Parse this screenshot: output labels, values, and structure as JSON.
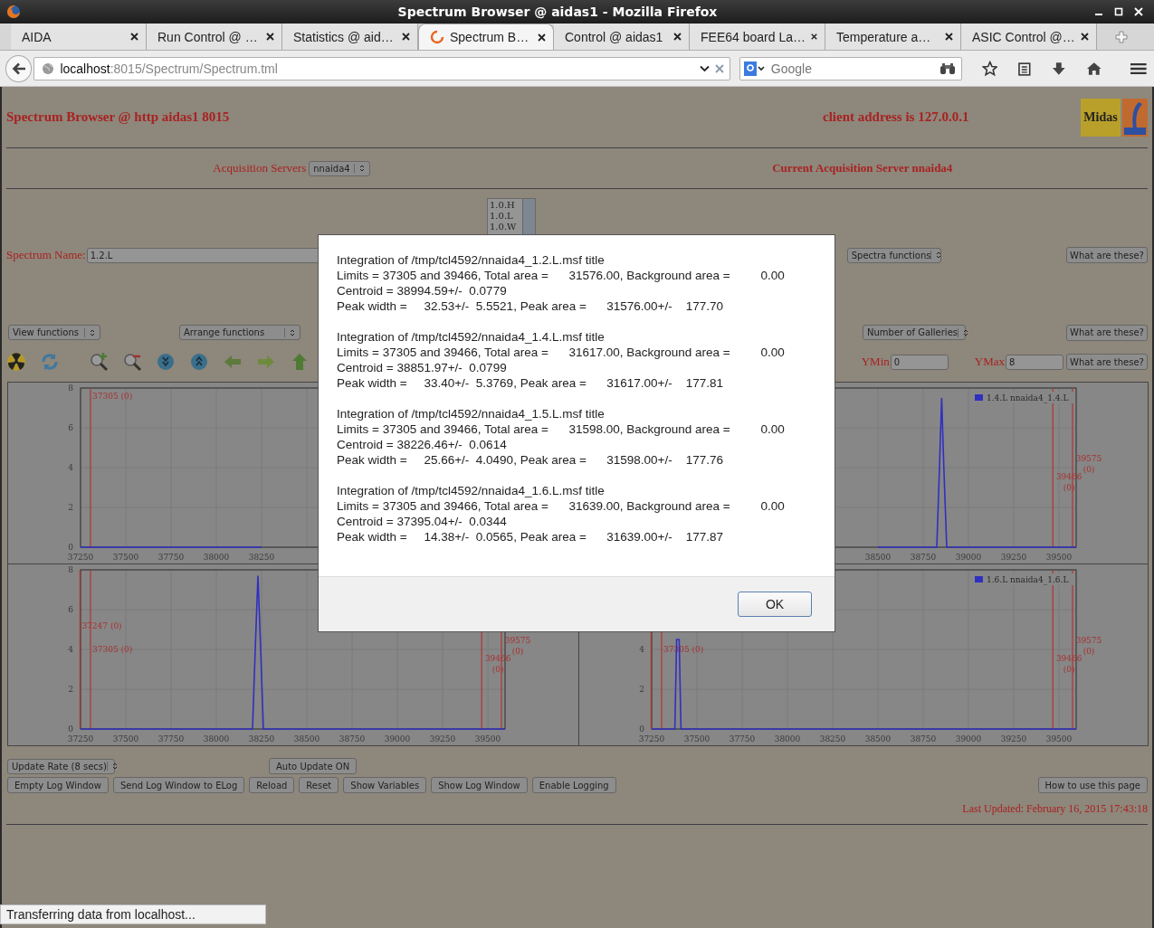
{
  "window": {
    "title": "Spectrum Browser @ aidas1 - Mozilla Firefox"
  },
  "tabs": [
    {
      "label": "AIDA",
      "selected": false,
      "loading": false
    },
    {
      "label": "Run Control @ …",
      "selected": false,
      "loading": false
    },
    {
      "label": "Statistics @ aid…",
      "selected": false,
      "loading": false
    },
    {
      "label": "Spectrum B…",
      "selected": true,
      "loading": true
    },
    {
      "label": "Control @ aidas1",
      "selected": false,
      "loading": false
    },
    {
      "label": "FEE64 board La…",
      "selected": false,
      "loading": false
    },
    {
      "label": "Temperature a…",
      "selected": false,
      "loading": false
    },
    {
      "label": "ASIC Control @…",
      "selected": false,
      "loading": false
    }
  ],
  "address_bar": {
    "host": "localhost",
    "path": ":8015/Spectrum/Spectrum.tml"
  },
  "search": {
    "placeholder": "Google"
  },
  "page": {
    "title": "Spectrum Browser @ http aidas1 8015",
    "client_address": "client address is 127.0.0.1",
    "logo_text": "Midas",
    "acquisition": {
      "label": "Acquisition Servers",
      "value": "nnaida4",
      "current": "Current Acquisition Server nnaida4"
    },
    "spectrum_list": [
      "1.0.H",
      "1.0.L",
      "1.0.W"
    ],
    "spectrum_name": {
      "label": "Spectrum Name:",
      "value": "1.2.L"
    },
    "spectra_functions": "Spectra functions",
    "help_buttons": [
      "What are these?",
      "What are these?",
      "What are these?"
    ],
    "view_functions": "View functions",
    "arrange_functions": "Arrange functions",
    "galleries": "Number of Galleries",
    "ymin": {
      "label": "YMin",
      "value": "0"
    },
    "ymax": {
      "label": "YMax",
      "value": "8"
    },
    "charts": [
      {
        "chart_data": {
          "type": "line",
          "xlim": [
            37250,
            39595
          ],
          "ylim": [
            0,
            8
          ],
          "xticks": [
            37250,
            37500,
            37750,
            38000,
            38250
          ],
          "yticks": [
            0,
            2,
            4,
            6,
            8
          ],
          "x": [
            37250,
            38250
          ],
          "series": [
            {
              "color": "#3030c0",
              "values": [
                0,
                0
              ]
            }
          ],
          "grid": true,
          "ref_lines": [
            {
              "axis": "x",
              "value": 37305,
              "label": "37305 (0)"
            }
          ]
        }
      },
      {
        "chart_data": {
          "type": "line",
          "xlim": [
            37250,
            39595
          ],
          "ylim": [
            0,
            8
          ],
          "xticks": [
            38500,
            38750,
            39000,
            39250,
            39500
          ],
          "x": [
            38500,
            38825,
            38840,
            38852,
            38864,
            38880,
            39595
          ],
          "series": [
            {
              "name": "1.4.L nnaida4_1.4.L",
              "color": "#3030c0",
              "values": [
                0,
                0,
                4,
                7.5,
                4,
                0,
                0
              ]
            }
          ],
          "grid": true,
          "ref_lines": [
            {
              "axis": "x",
              "value": 39466,
              "label": "39466 (0)"
            },
            {
              "axis": "x",
              "value": 39575,
              "label": "39575 (0)"
            }
          ]
        }
      },
      {
        "chart_data": {
          "type": "line",
          "xlim": [
            37250,
            39595
          ],
          "ylim": [
            0,
            8
          ],
          "xticks": [
            37250,
            37500,
            37750,
            38000,
            38250,
            38500,
            38750,
            39000,
            39250,
            39500
          ],
          "yticks": [
            0,
            2,
            4,
            6,
            8
          ],
          "x": [
            37250,
            38200,
            38215,
            38230,
            38245,
            38260,
            39595
          ],
          "series": [
            {
              "color": "#3030c0",
              "values": [
                0,
                0,
                4,
                7.7,
                4,
                0,
                0
              ]
            }
          ],
          "grid": true,
          "ref_lines": [
            {
              "axis": "x",
              "value": 37247,
              "label": "37247 (0)"
            },
            {
              "axis": "x",
              "value": 37305,
              "label": "37305 (0)"
            },
            {
              "axis": "x",
              "value": 39466,
              "label": "39466 (0)"
            },
            {
              "axis": "x",
              "value": 39575,
              "label": "39575 (0)"
            }
          ]
        }
      },
      {
        "chart_data": {
          "type": "line",
          "xlim": [
            37250,
            39595
          ],
          "ylim": [
            0,
            8
          ],
          "xticks": [
            37250,
            37500,
            37750,
            38000,
            38250,
            38500,
            38750,
            39000,
            39250,
            39500
          ],
          "yticks": [
            0,
            2,
            4
          ],
          "x": [
            37250,
            37378,
            37388,
            37402,
            37412,
            39595
          ],
          "series": [
            {
              "name": "1.6.L nnaida4_1.6.L",
              "color": "#3030c0",
              "values": [
                0,
                0,
                4.5,
                4.5,
                0,
                0
              ]
            }
          ],
          "grid": true,
          "ref_lines": [
            {
              "axis": "x",
              "value": 37247
            },
            {
              "axis": "x",
              "value": 37305,
              "label": "37305 (0)"
            },
            {
              "axis": "x",
              "value": 39466,
              "label": "39466 (0)"
            },
            {
              "axis": "x",
              "value": 39575,
              "label": "39575 (0)"
            }
          ]
        }
      }
    ],
    "update_rate": "Update Rate (8 secs)",
    "auto_update": "Auto Update ON",
    "buttons": [
      "Empty Log Window",
      "Send Log Window to ELog",
      "Reload",
      "Reset",
      "Show Variables",
      "Show Log Window",
      "Enable Logging"
    ],
    "help_page": "How to use this page",
    "last_updated": "Last Updated: February 16, 2015 17:43:18"
  },
  "dialog": {
    "results": [
      {
        "lines": [
          "Integration of /tmp/tcl4592/nnaida4_1.2.L.msf title",
          "Limits = 37305 and 39466, Total area =      31576.00, Background area =         0.00",
          "Centroid = 38994.59+/-  0.0779",
          "Peak width =     32.53+/-  5.5521, Peak area =      31576.00+/-    177.70"
        ]
      },
      {
        "lines": [
          "Integration of /tmp/tcl4592/nnaida4_1.4.L.msf title",
          "Limits = 37305 and 39466, Total area =      31617.00, Background area =         0.00",
          "Centroid = 38851.97+/-  0.0799",
          "Peak width =     33.40+/-  5.3769, Peak area =      31617.00+/-    177.81"
        ]
      },
      {
        "lines": [
          "Integration of /tmp/tcl4592/nnaida4_1.5.L.msf title",
          "Limits = 37305 and 39466, Total area =      31598.00, Background area =         0.00",
          "Centroid = 38226.46+/-  0.0614",
          "Peak width =     25.66+/-  4.0490, Peak area =      31598.00+/-    177.76"
        ]
      },
      {
        "lines": [
          "Integration of /tmp/tcl4592/nnaida4_1.6.L.msf title",
          "Limits = 37305 and 39466, Total area =      31639.00, Background area =         0.00",
          "Centroid = 37395.04+/-  0.0344",
          "Peak width =     14.38+/-  0.0565, Peak area =      31639.00+/-    177.87"
        ]
      }
    ],
    "ok": "OK"
  },
  "status": "Transferring data from localhost..."
}
